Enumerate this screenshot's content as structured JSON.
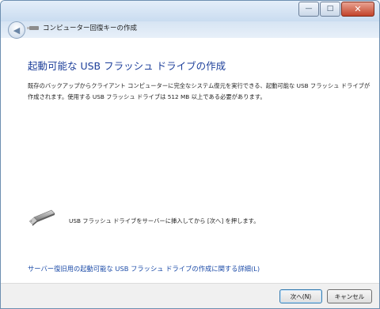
{
  "window": {
    "title": "コンピューター回復キーの作成",
    "controls": {
      "minimize": "—",
      "maximize": "□",
      "close": "✕"
    }
  },
  "nav": {
    "back_icon": "back-arrow-icon"
  },
  "content": {
    "heading": "起動可能な USB フラッシュ ドライブの作成",
    "description_line1": "既存のバックアップからクライアント コンピューターに完全なシステム復元を実行できる、起動可能な USB フラッシュ ドライブが",
    "description_line2": "作成されます。使用する USB フラッシュ ドライブは 512 MB 以上である必要があります。",
    "instruction": "USB フラッシュ ドライブをサーバーに挿入してから [次へ] を押します。",
    "details_link": "サーバー復旧用の起動可能な USB フラッシュ ドライブの作成に関する詳細(L)"
  },
  "footer": {
    "next_label": "次へ(N)",
    "cancel_label": "キャンセル"
  },
  "colors": {
    "heading": "#1d3f9a",
    "link": "#1d4ca8",
    "close_button": "#c2432a"
  }
}
